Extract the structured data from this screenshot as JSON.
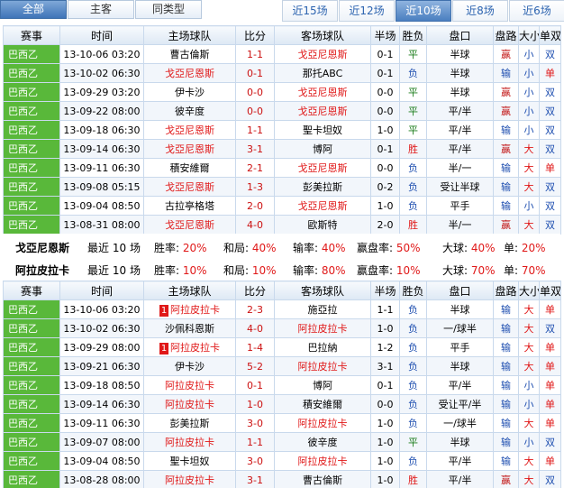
{
  "tabs_left": [
    {
      "label": "全部",
      "active": true
    },
    {
      "label": "主客",
      "active": false
    },
    {
      "label": "同类型",
      "active": false
    }
  ],
  "tabs_right": [
    {
      "label": "近15场",
      "active": false
    },
    {
      "label": "近12场",
      "active": false
    },
    {
      "label": "近10场",
      "active": true
    },
    {
      "label": "近8场",
      "active": false
    },
    {
      "label": "近6场",
      "active": false
    }
  ],
  "headers": [
    "赛事",
    "时间",
    "主场球队",
    "比分",
    "客场球队",
    "半场",
    "胜负",
    "盘口",
    "盘路",
    "大小",
    "单双"
  ],
  "league_color": "#59b83a",
  "table1": [
    {
      "league": "巴西乙",
      "time": "13-10-06 03:20",
      "home": "曹古倫斯",
      "score": "1-1",
      "away": "戈亞尼恩斯",
      "half": "0-1",
      "res": "平",
      "line": "半球",
      "ah": "赢",
      "ou": "小",
      "oe": "双"
    },
    {
      "league": "巴西乙",
      "time": "13-10-02 06:30",
      "home": "戈亞尼恩斯",
      "score": "0-1",
      "away": "那托ABC",
      "half": "0-1",
      "res": "负",
      "line": "半球",
      "ah": "输",
      "ou": "小",
      "oe": "单"
    },
    {
      "league": "巴西乙",
      "time": "13-09-29 03:20",
      "home": "伊卡沙",
      "score": "0-0",
      "away": "戈亞尼恩斯",
      "half": "0-0",
      "res": "平",
      "line": "半球",
      "ah": "赢",
      "ou": "小",
      "oe": "双"
    },
    {
      "league": "巴西乙",
      "time": "13-09-22 08:00",
      "home": "彼辛度",
      "score": "0-0",
      "away": "戈亞尼恩斯",
      "half": "0-0",
      "res": "平",
      "line": "平/半",
      "ah": "赢",
      "ou": "小",
      "oe": "双"
    },
    {
      "league": "巴西乙",
      "time": "13-09-18 06:30",
      "home": "戈亞尼恩斯",
      "score": "1-1",
      "away": "聖卡坦奴",
      "half": "1-0",
      "res": "平",
      "line": "平/半",
      "ah": "输",
      "ou": "小",
      "oe": "双"
    },
    {
      "league": "巴西乙",
      "time": "13-09-14 06:30",
      "home": "戈亞尼恩斯",
      "score": "3-1",
      "away": "博阿",
      "half": "0-1",
      "res": "胜",
      "line": "平/半",
      "ah": "赢",
      "ou": "大",
      "oe": "双"
    },
    {
      "league": "巴西乙",
      "time": "13-09-11 06:30",
      "home": "積安維爾",
      "score": "2-1",
      "away": "戈亞尼恩斯",
      "half": "0-0",
      "res": "负",
      "line": "半/一",
      "ah": "输",
      "ou": "大",
      "oe": "单"
    },
    {
      "league": "巴西乙",
      "time": "13-09-08 05:15",
      "home": "戈亞尼恩斯",
      "score": "1-3",
      "away": "彭美拉斯",
      "half": "0-2",
      "res": "负",
      "line": "受让半球",
      "ah": "输",
      "ou": "大",
      "oe": "双"
    },
    {
      "league": "巴西乙",
      "time": "13-09-04 08:50",
      "home": "古拉亭格塔",
      "score": "2-0",
      "away": "戈亞尼恩斯",
      "half": "1-0",
      "res": "负",
      "line": "平手",
      "ah": "输",
      "ou": "小",
      "oe": "双"
    },
    {
      "league": "巴西乙",
      "time": "13-08-31 08:00",
      "home": "戈亞尼恩斯",
      "score": "4-0",
      "away": "歐斯特",
      "half": "2-0",
      "res": "胜",
      "line": "半/一",
      "ah": "赢",
      "ou": "大",
      "oe": "双"
    }
  ],
  "summary1": {
    "team": "戈亞尼恩斯",
    "recent": "最近",
    "count": "10",
    "unit": "场",
    "win": "20%",
    "draw": "40%",
    "ah_lose": "40%",
    "ah_win": "50%",
    "over": "40%",
    "odd": "20%"
  },
  "summary2": {
    "team": "阿拉皮拉卡",
    "recent": "最近",
    "count": "10",
    "unit": "场",
    "win": "10%",
    "draw": "10%",
    "ah_lose": "80%",
    "ah_win": "10%",
    "over": "70%",
    "odd": "70%"
  },
  "summary_labels": {
    "win": "胜率:",
    "draw": "和局:",
    "ah_lose": "输率:",
    "ah_win": "赢盘率:",
    "over": "大球:",
    "odd": "单:"
  },
  "table2": [
    {
      "league": "巴西乙",
      "time": "13-10-06 03:20",
      "home_card": "1",
      "home": "阿拉皮拉卡",
      "score": "2-3",
      "away": "施亞拉",
      "half": "1-1",
      "res": "负",
      "line": "半球",
      "ah": "输",
      "ou": "大",
      "oe": "单"
    },
    {
      "league": "巴西乙",
      "time": "13-10-02 06:30",
      "home_card": "",
      "home": "沙佩科恩斯",
      "score": "4-0",
      "away": "阿拉皮拉卡",
      "half": "1-0",
      "res": "负",
      "line": "一/球半",
      "ah": "输",
      "ou": "大",
      "oe": "双"
    },
    {
      "league": "巴西乙",
      "time": "13-09-29 08:00",
      "home_card": "1",
      "home": "阿拉皮拉卡",
      "score": "1-4",
      "away": "巴拉納",
      "half": "1-2",
      "res": "负",
      "line": "平手",
      "ah": "输",
      "ou": "大",
      "oe": "单"
    },
    {
      "league": "巴西乙",
      "time": "13-09-21 06:30",
      "home_card": "",
      "home": "伊卡沙",
      "score": "5-2",
      "away": "阿拉皮拉卡",
      "half": "3-1",
      "res": "负",
      "line": "半球",
      "ah": "输",
      "ou": "大",
      "oe": "单"
    },
    {
      "league": "巴西乙",
      "time": "13-09-18 08:50",
      "home_card": "",
      "home": "阿拉皮拉卡",
      "score": "0-1",
      "away": "博阿",
      "half": "0-1",
      "res": "负",
      "line": "平/半",
      "ah": "输",
      "ou": "小",
      "oe": "单"
    },
    {
      "league": "巴西乙",
      "time": "13-09-14 06:30",
      "home_card": "",
      "home": "阿拉皮拉卡",
      "score": "1-0",
      "away": "積安維爾",
      "half": "0-0",
      "res": "负",
      "line": "受让平/半",
      "ah": "输",
      "ou": "小",
      "oe": "单"
    },
    {
      "league": "巴西乙",
      "time": "13-09-11 06:30",
      "home_card": "",
      "home": "彭美拉斯",
      "score": "3-0",
      "away": "阿拉皮拉卡",
      "half": "1-0",
      "res": "负",
      "line": "一/球半",
      "ah": "输",
      "ou": "大",
      "oe": "单"
    },
    {
      "league": "巴西乙",
      "time": "13-09-07 08:00",
      "home_card": "",
      "home": "阿拉皮拉卡",
      "score": "1-1",
      "away": "彼辛度",
      "half": "1-0",
      "res": "平",
      "line": "半球",
      "ah": "输",
      "ou": "小",
      "oe": "双"
    },
    {
      "league": "巴西乙",
      "time": "13-09-04 08:50",
      "home_card": "",
      "home": "聖卡坦奴",
      "score": "3-0",
      "away": "阿拉皮拉卡",
      "half": "1-0",
      "res": "负",
      "line": "平/半",
      "ah": "输",
      "ou": "大",
      "oe": "单"
    },
    {
      "league": "巴西乙",
      "time": "13-08-28 08:00",
      "home_card": "",
      "home": "阿拉皮拉卡",
      "score": "3-1",
      "away": "曹古倫斯",
      "half": "1-0",
      "res": "胜",
      "line": "平/半",
      "ah": "赢",
      "ou": "大",
      "oe": "双"
    }
  ]
}
